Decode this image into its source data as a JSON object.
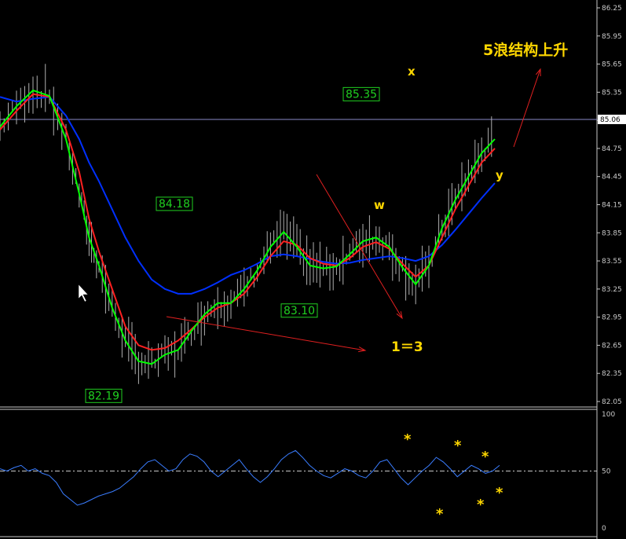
{
  "chart_data": [
    {
      "type": "line",
      "series": [
        {
          "color": "#00ff00",
          "x": [
            0,
            5,
            10,
            15,
            20,
            24,
            27,
            30,
            34,
            38,
            42,
            46,
            50,
            54,
            58,
            62,
            66,
            70,
            74,
            78,
            82,
            86,
            90,
            94,
            98,
            102,
            106,
            110,
            114,
            118,
            122,
            126,
            130,
            134,
            138,
            142,
            146,
            150
          ],
          "values": [
            84.98,
            85.2,
            85.37,
            85.31,
            84.85,
            84.27,
            83.8,
            83.5,
            83.05,
            82.7,
            82.48,
            82.45,
            82.55,
            82.6,
            82.8,
            82.98,
            83.1,
            83.1,
            83.25,
            83.45,
            83.7,
            83.86,
            83.7,
            83.5,
            83.47,
            83.49,
            83.62,
            83.76,
            83.8,
            83.7,
            83.48,
            83.3,
            83.5,
            83.9,
            84.2,
            84.45,
            84.7,
            84.85
          ]
        },
        {
          "color": "#ff2020",
          "x": [
            0,
            5,
            10,
            15,
            20,
            24,
            27,
            30,
            34,
            38,
            42,
            46,
            50,
            54,
            58,
            62,
            66,
            70,
            74,
            78,
            82,
            86,
            90,
            94,
            98,
            102,
            106,
            110,
            114,
            118,
            122,
            126,
            130,
            134,
            138,
            142,
            146,
            150
          ],
          "values": [
            84.95,
            85.15,
            85.33,
            85.3,
            84.95,
            84.5,
            84.0,
            83.65,
            83.25,
            82.85,
            82.65,
            82.6,
            82.62,
            82.7,
            82.82,
            82.95,
            83.05,
            83.1,
            83.2,
            83.38,
            83.6,
            83.76,
            83.72,
            83.58,
            83.52,
            83.5,
            83.58,
            83.7,
            83.75,
            83.68,
            83.52,
            83.38,
            83.5,
            83.8,
            84.1,
            84.35,
            84.6,
            84.75
          ]
        },
        {
          "color": "#0030ff",
          "x": [
            0,
            5,
            10,
            15,
            20,
            24,
            27,
            30,
            34,
            38,
            42,
            46,
            50,
            54,
            58,
            62,
            66,
            70,
            74,
            78,
            82,
            86,
            90,
            94,
            98,
            102,
            106,
            110,
            114,
            118,
            122,
            126,
            130,
            134,
            138,
            142,
            146,
            150
          ],
          "values": [
            85.3,
            85.25,
            85.28,
            85.3,
            85.1,
            84.85,
            84.6,
            84.4,
            84.1,
            83.8,
            83.55,
            83.35,
            83.25,
            83.2,
            83.2,
            83.25,
            83.32,
            83.4,
            83.45,
            83.52,
            83.6,
            83.62,
            83.6,
            83.57,
            83.54,
            83.52,
            83.53,
            83.56,
            83.58,
            83.6,
            83.58,
            83.55,
            83.6,
            83.72,
            83.88,
            84.05,
            84.22,
            84.38
          ]
        }
      ],
      "xlabel": "",
      "ylabel": "",
      "ylim": [
        82.05,
        86.25
      ],
      "y_ticks": [
        "86.25",
        "85.95",
        "85.65",
        "85.35",
        "85.05",
        "84.75",
        "84.45",
        "84.15",
        "83.85",
        "83.55",
        "83.25",
        "82.95",
        "82.65",
        "82.35",
        "82.05"
      ],
      "current_price": "85.06",
      "labels": [
        "85.35",
        "84.18",
        "83.10",
        "82.19"
      ],
      "annotations": [
        "5浪结构上升",
        "x",
        "w",
        "y",
        "1＝3"
      ],
      "grid": false,
      "background": "#000000"
    },
    {
      "type": "line",
      "series": [
        {
          "color": "#3a7dff",
          "values": [
            52,
            50,
            53,
            55,
            50,
            52,
            48,
            46,
            40,
            30,
            25,
            20,
            22,
            25,
            28,
            30,
            32,
            35,
            40,
            45,
            52,
            58,
            60,
            55,
            50,
            52,
            60,
            65,
            63,
            58,
            50,
            45,
            50,
            55,
            60,
            52,
            45,
            40,
            45,
            52,
            60,
            65,
            68,
            62,
            55,
            50,
            46,
            44,
            48,
            52,
            50,
            46,
            44,
            50,
            58,
            60,
            52,
            44,
            38,
            44,
            50,
            55,
            62,
            58,
            52,
            45,
            50,
            55,
            52,
            48,
            50,
            55
          ]
        }
      ],
      "y_ticks": [
        "100",
        "50",
        "0"
      ],
      "reference_line": 50,
      "ylim": [
        0,
        100
      ],
      "annotations": [
        "*",
        "*",
        "*",
        "*",
        "*",
        "*",
        "*"
      ]
    }
  ]
}
